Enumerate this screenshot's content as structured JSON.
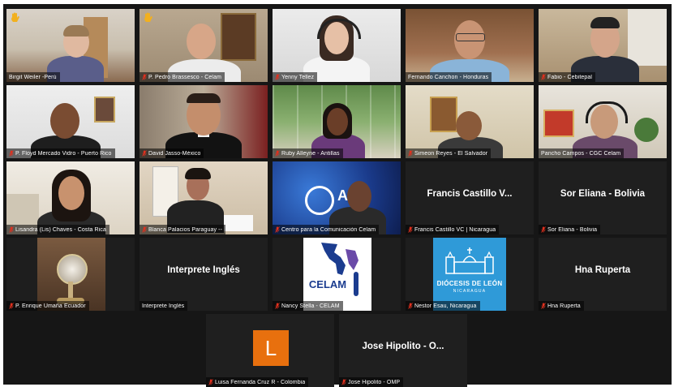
{
  "participants": [
    {
      "name": "Birgit Weiler -Perú"
    },
    {
      "name": "P. Pedro Brassesco - Celam"
    },
    {
      "name": "Yenny Tellez"
    },
    {
      "name": "Fernando Canchon - Honduras"
    },
    {
      "name": "Fabio - Cebitepal"
    },
    {
      "name": "P. Floyd Mercado Vidro - Puerto Rico"
    },
    {
      "name": "David Jasso-México"
    },
    {
      "name": "Ruby Alleyne - Antillas"
    },
    {
      "name": "Simeon Reyes - El Salvador"
    },
    {
      "name": "Pancho Campos - CGC Celam"
    },
    {
      "name": "Lisandra (Lis) Chaves - Costa Rica"
    },
    {
      "name": "Blanca Palacios Paraguay --"
    },
    {
      "name": "Centro para la Comunicación Celam",
      "logo_text": "A"
    },
    {
      "name": "Francis Castillo VC | Nicaragua",
      "display": "Francis Castillo V..."
    },
    {
      "name": "Sor Eliana - Bolivia",
      "display": "Sor Eliana - Bolivia"
    },
    {
      "name": "P. Enrique Umaña  Ecuador"
    },
    {
      "name": "Interprete Inglés",
      "display": "Interprete Inglés"
    },
    {
      "name": "Nancy Stella - CELAM",
      "logo_text": "CELAM"
    },
    {
      "name": "Nestor Esau, Nicaragua",
      "logo_title": "DIÓCESIS DE LEÓN",
      "logo_sub": "NICARAGUA"
    },
    {
      "name": "Hna Ruperta",
      "display": "Hna Ruperta"
    },
    {
      "name": "Luisa Fernanda Cruz R - Colombia",
      "avatar_letter": "L"
    },
    {
      "name": "Jose Hipolito - OMP",
      "display": "Jose Hipolito - O..."
    }
  ],
  "colors": {
    "background": "#161616",
    "tile": "#1f1f1f",
    "active_border": "#c8d94a",
    "muted_mic": "#e0301e",
    "raise_hand": "#f2b01e",
    "avatar_orange": "#e8700e",
    "celam_blue": "#1b3c8f",
    "leon_blue": "#2f9ad8"
  }
}
